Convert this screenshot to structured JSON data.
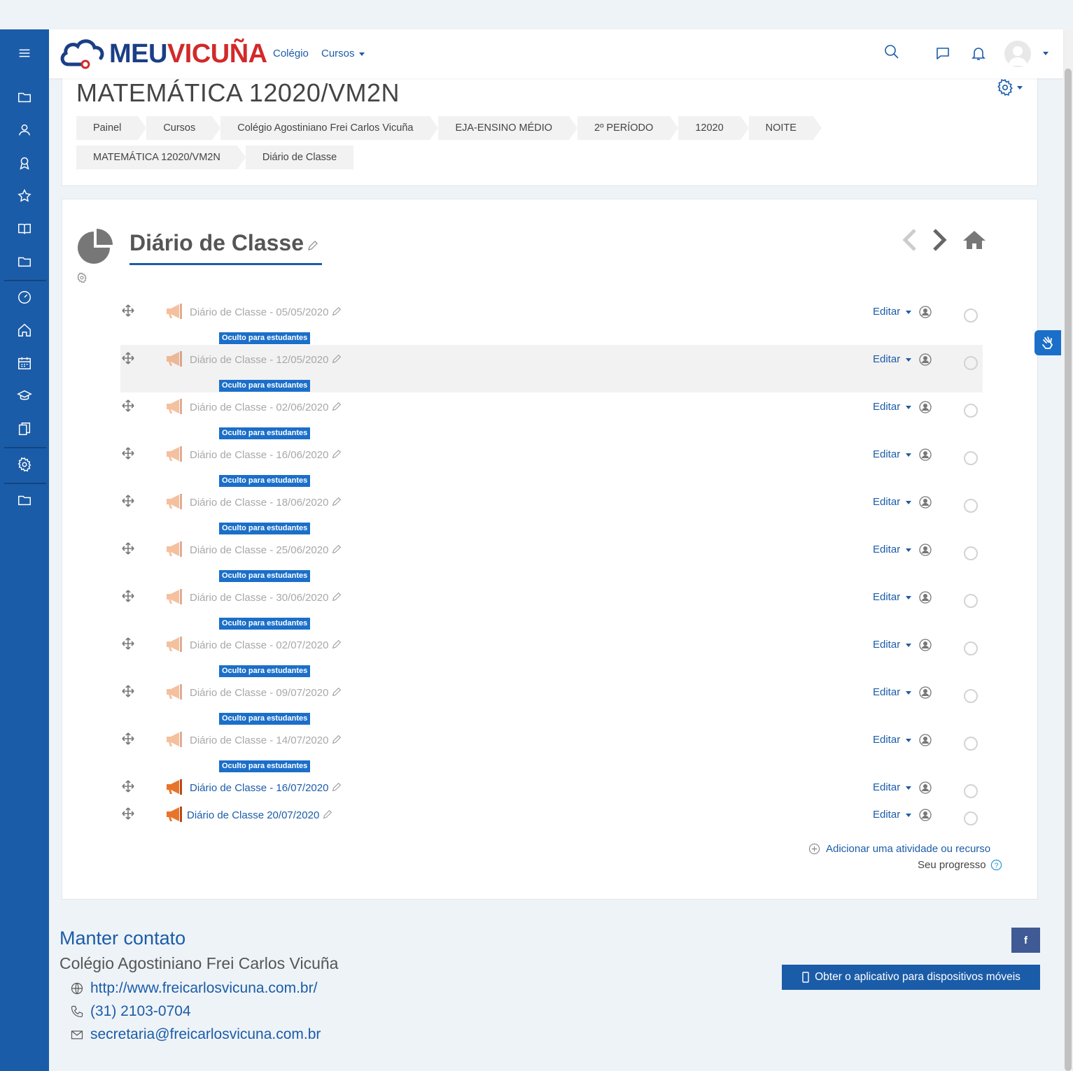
{
  "navbar": {
    "logo_part1": "MEU",
    "logo_part2": "VICUÑA",
    "link_colegio": "Colégio",
    "link_cursos": "Cursos"
  },
  "header": {
    "title": "MATEMÁTICA 12020/VM2N",
    "breadcrumbs": [
      "Painel",
      "Cursos",
      "Colégio Agostiniano Frei Carlos Vicuña",
      "EJA-ENSINO MÉDIO",
      "2º PERÍODO",
      "12020",
      "NOITE",
      "MATEMÁTICA 12020/VM2N",
      "Diário de Classe"
    ]
  },
  "section": {
    "title": "Diário de Classe"
  },
  "activities": [
    {
      "name": "Diário de Classe - 05/05/2020",
      "hidden": true
    },
    {
      "name": "Diário de Classe - 12/05/2020",
      "hidden": true
    },
    {
      "name": "Diário de Classe - 02/06/2020",
      "hidden": true
    },
    {
      "name": "Diário de Classe - 16/06/2020",
      "hidden": true
    },
    {
      "name": "Diário de Classe - 18/06/2020",
      "hidden": true
    },
    {
      "name": "Diário de Classe - 25/06/2020",
      "hidden": true
    },
    {
      "name": "Diário de Classe - 30/06/2020",
      "hidden": true
    },
    {
      "name": "Diário de Classe - 02/07/2020",
      "hidden": true
    },
    {
      "name": "Diário de Classe - 09/07/2020",
      "hidden": true
    },
    {
      "name": "Diário de Classe - 14/07/2020",
      "hidden": true
    },
    {
      "name": "Diário de Classe - 16/07/2020",
      "hidden": false
    },
    {
      "name": "Diário de Classe 20/07/2020",
      "hidden": false
    }
  ],
  "labels": {
    "hidden_badge": "Oculto para estudantes",
    "edit": "Editar",
    "add_activity": "Adicionar uma atividade ou recurso",
    "progress": "Seu progresso"
  },
  "footer": {
    "title": "Manter contato",
    "school": "Colégio Agostiniano Frei Carlos Vicuña",
    "website": "http://www.freicarlosvicuna.com.br/",
    "phone": "(31) 2103-0704",
    "email": "secretaria@freicarlosvicuna.com.br",
    "facebook": "f",
    "app_button": "Obter o aplicativo para dispositivos móveis"
  },
  "colors": {
    "primary": "#1b5ca8",
    "logo_red": "#d12a2a",
    "badge": "#1b6fc9",
    "megaphone": "#e8742b"
  },
  "icons": [
    "menu-icon",
    "folder-icon",
    "user-icon",
    "badge-icon",
    "star-icon",
    "book-icon",
    "dashboard-icon",
    "home-icon",
    "calendar-icon",
    "graduation-cap-icon",
    "files-icon",
    "gear-icon",
    "search-icon",
    "chat-icon",
    "bell-icon",
    "move-icon",
    "megaphone-icon",
    "pencil-icon",
    "person-icon",
    "pie-chart-icon",
    "chevron-left-icon",
    "chevron-right-icon",
    "house-icon",
    "plus-circle-icon",
    "help-icon",
    "globe-icon",
    "phone-icon",
    "mail-icon",
    "mobile-icon",
    "sign-language-icon"
  ]
}
